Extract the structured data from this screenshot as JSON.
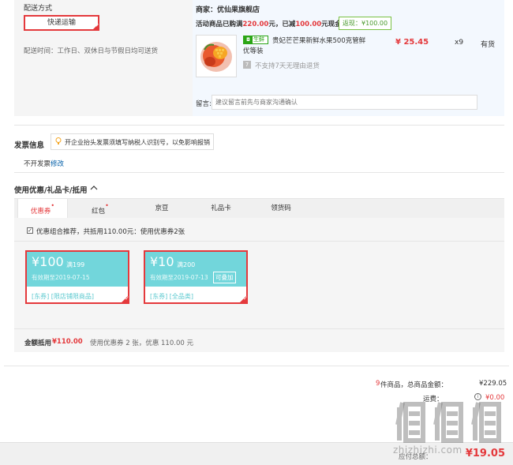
{
  "delivery": {
    "title": "配送方式",
    "method": "快递运输",
    "time": "配送时间：工作日、双休日与节假日均可送货"
  },
  "shop": {
    "name": "商家：优仙果旗舰店",
    "promo_prefix": "活动商品已购满",
    "promo_amount1": "220.00",
    "promo_mid": "元，已减",
    "promo_amount2": "100.00",
    "promo_suffix": "元现金",
    "rebate": "返现：¥100.00",
    "product": {
      "fresh_tag": "生鲜",
      "name": "贵妃芒芒果新鲜水果500克管鲜优等装",
      "price": "¥ 25.45",
      "qty": "x9",
      "stock": "有货",
      "return_icon": "7",
      "return_policy": "不支持7天无理由退货"
    },
    "message_label": "留言:",
    "message_placeholder": "建议留言前先与商家沟通确认"
  },
  "invoice": {
    "title": "发票信息",
    "tip": "开企业抬头发票须填写纳税人识别号，以免影响报销",
    "value": "不开发票",
    "edit": "修改"
  },
  "coupons": {
    "title": "使用优惠/礼品卡/抵用",
    "tabs": [
      {
        "label": "优惠券",
        "dot": "•"
      },
      {
        "label": "红包",
        "dot": "•"
      },
      {
        "label": "京豆",
        "dot": ""
      },
      {
        "label": "礼品卡",
        "dot": ""
      },
      {
        "label": "领货码",
        "dot": ""
      }
    ],
    "combo_text": "优惠组合推荐，共抵用110.00元：使用优惠券2张",
    "cards": [
      {
        "amount": "¥100",
        "cond": "满199",
        "expiry": "有效期至2019-07-15",
        "badge": "",
        "scope": "[东券] [限店铺限商品]"
      },
      {
        "amount": "¥10",
        "cond": "满200",
        "expiry": "有效期至2019-07-13",
        "badge": "可叠加",
        "scope": "[东券] [全品类]"
      }
    ],
    "summary_label": "金额抵用",
    "summary_amount": "¥110.00",
    "summary_desc": "使用优惠券 2 张，优惠 110.00 元"
  },
  "totals": {
    "items_count": "9",
    "items_label": "件商品，总商品金额：",
    "items_value": "¥229.05",
    "shipping_label": "运费：",
    "shipping_value": "¥0.00",
    "pay_label": "应付总额：",
    "pay_value": "¥19.05"
  },
  "watermark": "zhizhizhi.com",
  "colors": {
    "accent": "#e4393c",
    "coupon": "#72d6db",
    "fresh": "#2aa515",
    "link": "#005ea7"
  }
}
